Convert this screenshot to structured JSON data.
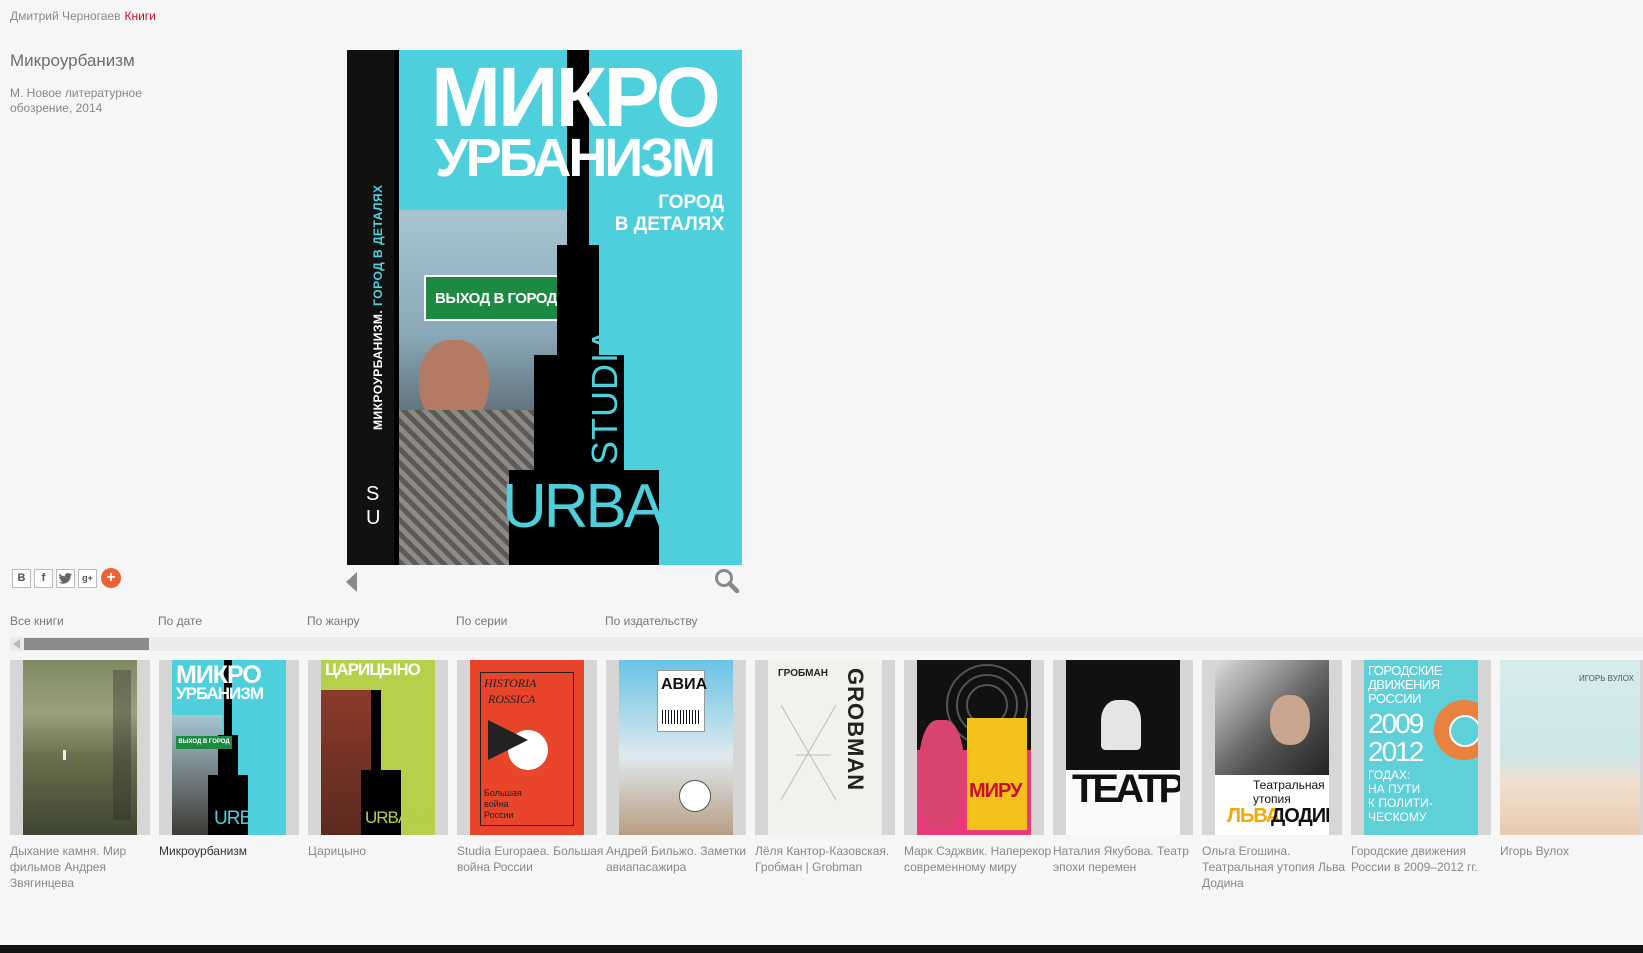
{
  "breadcrumb": {
    "author": "Дмитрий Черногаев",
    "section": "Книги"
  },
  "book": {
    "title": "Микроурбанизм",
    "meta": "М. Новое литературное обозрение, 2014"
  },
  "cover": {
    "spine_title": "МИКРОУРБАНИЗМ.",
    "spine_subtitle": "ГОРОД В ДЕТАЛЯХ",
    "spine_series": "S U",
    "title_line1": "МИКРО",
    "title_line2": "УРБАНИЗМ",
    "subtitle_line1": "ГОРОД",
    "subtitle_line2": "В ДЕТАЛЯХ",
    "sign": "ВЫХОД В ГОРОД",
    "series_line1": "STUDIA",
    "series_line2": "URBANICA"
  },
  "share": [
    "В",
    "f",
    "t",
    "g+",
    "+"
  ],
  "tabs": [
    "Все книги",
    "По дате",
    "По жанру",
    "По серии",
    "По издательству"
  ],
  "shelf": [
    {
      "caption": "Дыхание камня. Мир фильмов Андрея Звягинцева",
      "cover_text": ""
    },
    {
      "caption": "Микроурбанизм",
      "cover_text": "МИКРО УРБАНИЗМ"
    },
    {
      "caption": "Царицыно",
      "cover_text": "ЦАРИЦЫНО"
    },
    {
      "caption": "Studia Europaea. Большая война России",
      "cover_text": "HISTORIA ROSSICA"
    },
    {
      "caption": "Андрей Бильжо. Заметки авиапасажира",
      "cover_text": "АВИА"
    },
    {
      "caption": "Лёля Кантор-Казовская. Гробман | Grobman",
      "cover_text": "ГРОБМАН"
    },
    {
      "caption": "Марк Сэджвик. Наперекор современному миру",
      "cover_text": "МИРУ"
    },
    {
      "caption": "Наталия Якубова. Театр эпохи перемен",
      "cover_text": "ТЕАТР"
    },
    {
      "caption": "Ольга Егошина. Театральная утопия Льва Додина",
      "cover_text": "ЛЬВА ДОДИНА"
    },
    {
      "caption": "Городские движения России в 2009–2012 гг.",
      "cover_text": "ГОРОДСКИЕ ДВИЖЕНИЯ РОССИИ В 2009 2012 ГОДАХ: НА ПУТИ К ПОЛИТИ- ЧЕСКОМУ"
    },
    {
      "caption": "Игорь Вулох",
      "cover_text": "ИГОРЬ ВУЛОХ"
    }
  ],
  "active_index": 1,
  "colors": {
    "accent": "#c8102e",
    "cover_cyan": "#4ed0dc"
  },
  "icons": {
    "prev": "chevron-left-icon",
    "zoom": "magnifier-icon"
  }
}
